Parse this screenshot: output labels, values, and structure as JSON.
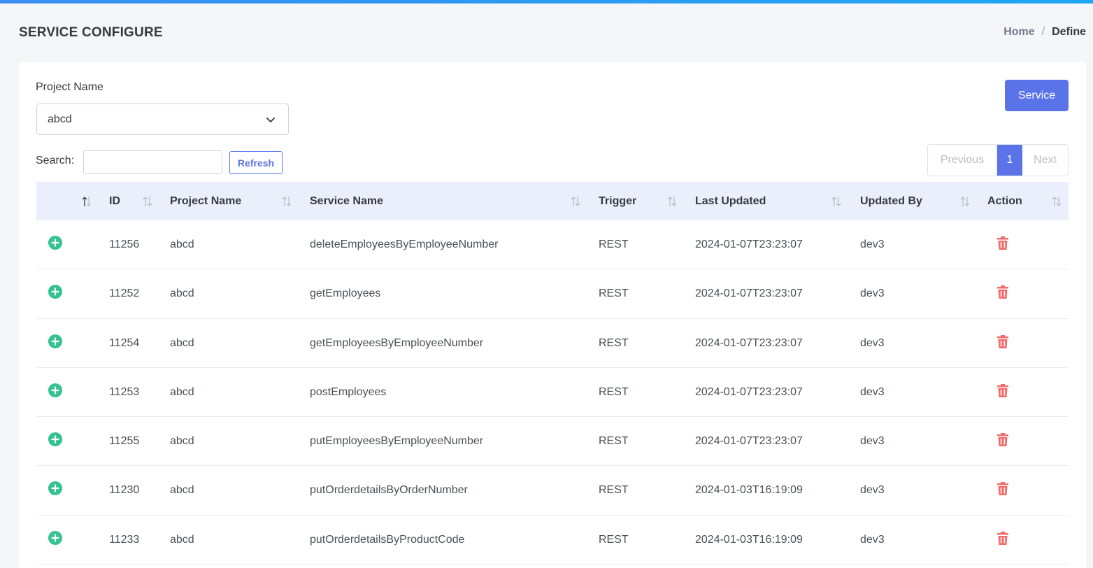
{
  "header": {
    "title": "SERVICE CONFIGURE",
    "breadcrumb": {
      "home": "Home",
      "separator": "/",
      "current": "Define"
    }
  },
  "form": {
    "project_label": "Project Name",
    "project_value": "abcd",
    "service_button": "Service",
    "search_label": "Search:",
    "search_value": "",
    "refresh_button": "Refresh"
  },
  "pagination": {
    "previous": "Previous",
    "current": "1",
    "next": "Next"
  },
  "table": {
    "headers": [
      "",
      "ID",
      "Project Name",
      "Service Name",
      "Trigger",
      "Last Updated",
      "Updated By",
      "Action"
    ],
    "rows": [
      {
        "id": "11256",
        "project": "abcd",
        "service": "deleteEmployeesByEmployeeNumber",
        "trigger": "REST",
        "updated": "2024-01-07T23:23:07",
        "by": "dev3"
      },
      {
        "id": "11252",
        "project": "abcd",
        "service": "getEmployees",
        "trigger": "REST",
        "updated": "2024-01-07T23:23:07",
        "by": "dev3"
      },
      {
        "id": "11254",
        "project": "abcd",
        "service": "getEmployeesByEmployeeNumber",
        "trigger": "REST",
        "updated": "2024-01-07T23:23:07",
        "by": "dev3"
      },
      {
        "id": "11253",
        "project": "abcd",
        "service": "postEmployees",
        "trigger": "REST",
        "updated": "2024-01-07T23:23:07",
        "by": "dev3"
      },
      {
        "id": "11255",
        "project": "abcd",
        "service": "putEmployeesByEmployeeNumber",
        "trigger": "REST",
        "updated": "2024-01-07T23:23:07",
        "by": "dev3"
      },
      {
        "id": "11230",
        "project": "abcd",
        "service": "putOrderdetailsByOrderNumber",
        "trigger": "REST",
        "updated": "2024-01-03T16:19:09",
        "by": "dev3"
      },
      {
        "id": "11233",
        "project": "abcd",
        "service": "putOrderdetailsByProductCode",
        "trigger": "REST",
        "updated": "2024-01-03T16:19:09",
        "by": "dev3"
      }
    ]
  },
  "colors": {
    "accent": "#5b73e8",
    "expand": "#34c38f",
    "delete": "#f46a6a",
    "header_bg": "#ebeffb"
  },
  "icons": {
    "expand": "plus-circle-icon",
    "delete": "trash-icon",
    "select": "chevron-down-icon",
    "sort": "sort-arrows-icon"
  }
}
